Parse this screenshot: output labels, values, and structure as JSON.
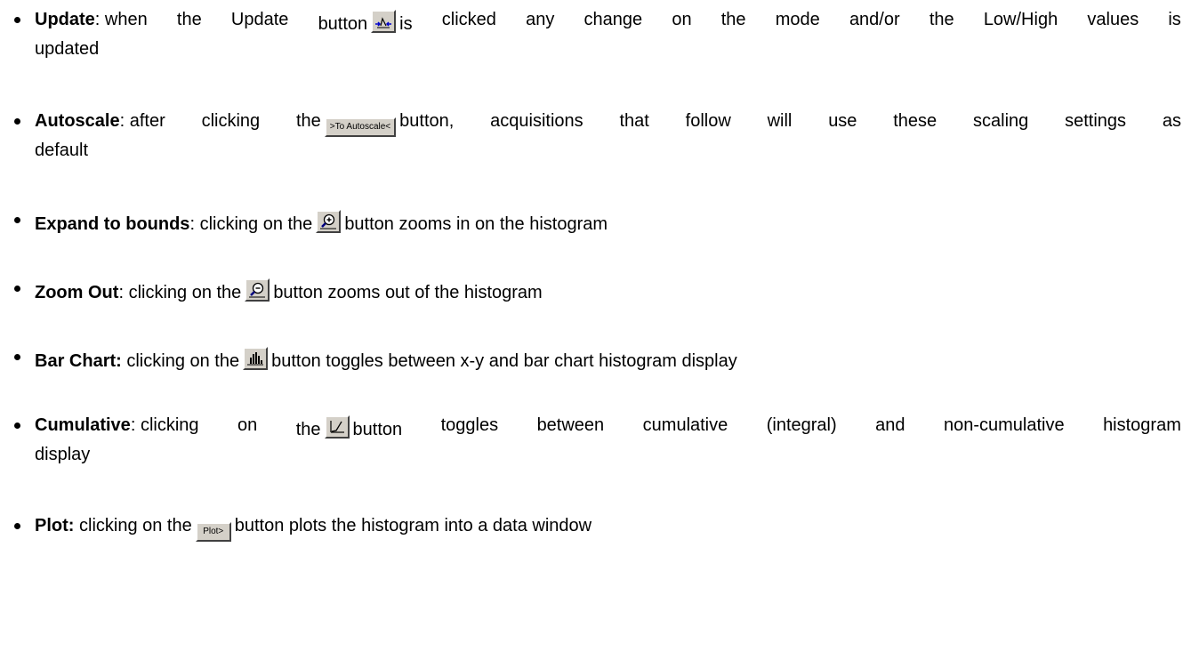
{
  "items": [
    {
      "term": "Update",
      "sep": ": ",
      "words1": [
        "when",
        "the",
        "Update",
        "button"
      ],
      "icon": "update-icon",
      "words2": [
        "is",
        "clicked",
        "any",
        "change",
        "on",
        "the",
        "mode",
        "and/or",
        "the",
        "Low/High",
        "values",
        "is"
      ],
      "cont": "updated"
    },
    {
      "term": "Autoscale",
      "sep": ": ",
      "words1": [
        "after",
        "clicking",
        "the"
      ],
      "button_label": ">To Autoscale<",
      "words2": [
        "button,",
        "acquisitions",
        "that",
        "follow",
        "will",
        "use",
        "these",
        "scaling",
        "settings",
        "as"
      ],
      "cont": "default"
    },
    {
      "term": "Expand to bounds",
      "sep": ": ",
      "pre": "clicking on the",
      "icon": "zoom-in-icon",
      "post": "button zooms in on the histogram"
    },
    {
      "term": "Zoom Out",
      "sep": ": ",
      "pre": "clicking on the",
      "icon": "zoom-out-icon",
      "post": "button zooms out of the histogram"
    },
    {
      "term": "Bar Chart:",
      "sep": " ",
      "pre": "clicking on the",
      "icon": "bar-chart-icon",
      "post": "button toggles between x-y and bar chart histogram display"
    },
    {
      "term": "Cumulative",
      "sep": ": ",
      "words1": [
        "clicking",
        "on",
        "the"
      ],
      "icon": "cumulative-icon",
      "words2": [
        "button",
        "toggles",
        "between",
        "cumulative",
        "(integral)",
        "and",
        "non-cumulative",
        "histogram"
      ],
      "cont": "display"
    },
    {
      "term": "Plot:",
      "sep": " ",
      "pre": "clicking on the",
      "button_label": "Plot>",
      "post": "button plots the histogram into a data window"
    }
  ]
}
